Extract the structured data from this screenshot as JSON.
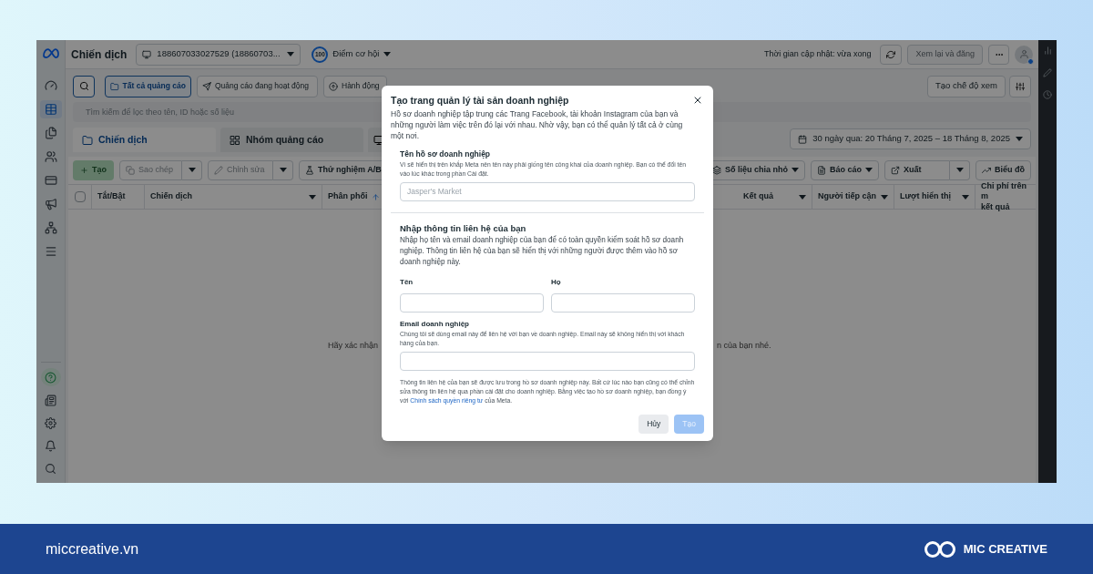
{
  "sidebar": {
    "items": [
      {
        "selected": false
      },
      {
        "selected": true
      },
      {
        "selected": false
      },
      {
        "selected": false
      },
      {
        "selected": false
      },
      {
        "selected": false
      },
      {
        "selected": false
      },
      {
        "selected": false
      }
    ],
    "bottom_items": [
      {
        "selected": false
      },
      {
        "selected": false
      },
      {
        "selected": false
      },
      {
        "selected": false
      },
      {
        "selected": false
      }
    ]
  },
  "top_bar": {
    "title": "Chiến dịch",
    "account": "188607033027529 (18860703...",
    "score_badge": "100",
    "score_label": "Điểm cơ hội",
    "update_status": "Thời gian cập nhật: vừa xong",
    "review_button": {
      "label": "Xem lại và đăng",
      "disabled": true
    }
  },
  "filters": [
    {
      "label": "Tất cả quảng cáo",
      "selected": true
    },
    {
      "label": "Quảng cáo đang hoạt động",
      "selected": false
    },
    {
      "label": "Hành động",
      "selected": false
    }
  ],
  "create_view_button": "Tạo chế độ xem",
  "search": {
    "placeholder": "Tìm kiếm để lọc theo tên, ID hoặc số liệu"
  },
  "tabs": [
    {
      "label": "Chiến dịch",
      "selected": true
    },
    {
      "label": "Nhóm quảng cáo",
      "selected": false
    }
  ],
  "date_range": "30 ngày qua: 20 Tháng 7, 2025 – 18 Tháng 8, 2025",
  "actions_left": [
    {
      "kind": "primary",
      "label": "Tạo",
      "disabled": true
    },
    {
      "kind": "split",
      "label": "Sao chép",
      "disabled": true
    },
    {
      "kind": "split",
      "label": "Chỉnh sửa",
      "disabled": true
    },
    {
      "kind": "plain",
      "label": "Thử nghiệm A/B",
      "disabled": false
    }
  ],
  "actions_right": [
    {
      "kind": "dropdown",
      "label": "Số liệu chia nhỏ",
      "disabled": false
    },
    {
      "kind": "dropdown",
      "label": "Báo cáo",
      "disabled": false
    },
    {
      "kind": "split",
      "label": "Xuất",
      "disabled": false
    },
    {
      "kind": "plain",
      "label": "Biểu đồ",
      "disabled": false
    }
  ],
  "table": {
    "select_all": {
      "checked": false
    },
    "columns_left": [
      {
        "label": "Tắt/Bật",
        "sorted_up": false,
        "has_menu": false
      },
      {
        "label": "Chiến dịch",
        "sorted_up": false,
        "has_menu": true
      },
      {
        "label": "Phân phối",
        "sorted_up": true,
        "has_menu": false
      }
    ],
    "columns_right": [
      {
        "label": "Kết quả",
        "sorted_up": false,
        "has_menu": true
      },
      {
        "label": "Người tiếp cận",
        "sorted_up": false,
        "has_menu": true
      },
      {
        "label": "Lượt hiển thị",
        "sorted_up": false,
        "has_menu": true
      },
      {
        "label": "Chi phí trên m\nkết quả",
        "sorted_up": false,
        "has_menu": false
      }
    ]
  },
  "empty_state": {
    "left_part": "Hãy xác nhận",
    "right_part": "n của bạn nhé."
  },
  "dialog": {
    "title": "Tạo trang quản lý tài sản doanh nghiệp",
    "description": "Hồ sơ doanh nghiệp tập trung các Trang Facebook, tài khoản Instagram của bạn và những người làm việc trên đó lại với nhau. Nhờ vậy, bạn có thể quản lý tất cả ở cùng một nơi.",
    "name_label": "Tên hồ sơ doanh nghiệp",
    "name_hint": "Vì sẽ hiển thị trên khắp Meta nên tên này phải giống tên công khai của doanh nghiệp. Bạn có thể đổi tên vào lúc khác trong phần Cài đặt.",
    "name_placeholder": "Jasper's Market",
    "contact_heading": "Nhập thông tin liên hệ của bạn",
    "contact_description": "Nhập họ tên và email doanh nghiệp của bạn để có toàn quyền kiểm soát hồ sơ doanh nghiệp. Thông tin liên hệ của bạn sẽ hiển thị với những người được thêm vào hồ sơ doanh nghiệp này.",
    "first_name_label": "Tên",
    "last_name_label": "Họ",
    "email_label": "Email doanh nghiệp",
    "email_hint": "Chúng tôi sẽ dùng email này để liên hệ với bạn về doanh nghiệp. Email này sẽ không hiển thị với khách hàng của bạn.",
    "notice_before": "Thông tin liên hệ của bạn sẽ được lưu trong hồ sơ doanh nghiệp này. Bất cứ lúc nào bạn cũng có thể chỉnh sửa thông tin liên hệ qua phần cài đặt cho doanh nghiệp. Bằng việc tạo hồ sơ doanh nghiệp, bạn đồng ý với ",
    "notice_link": "Chính sách quyền riêng tư",
    "notice_after": " của Meta.",
    "cancel_button": "Hủy",
    "submit_button": {
      "label": "Tạo",
      "disabled": true
    }
  },
  "footer": {
    "site": "miccreative.vn",
    "brand": "MIC CREATIVE"
  }
}
